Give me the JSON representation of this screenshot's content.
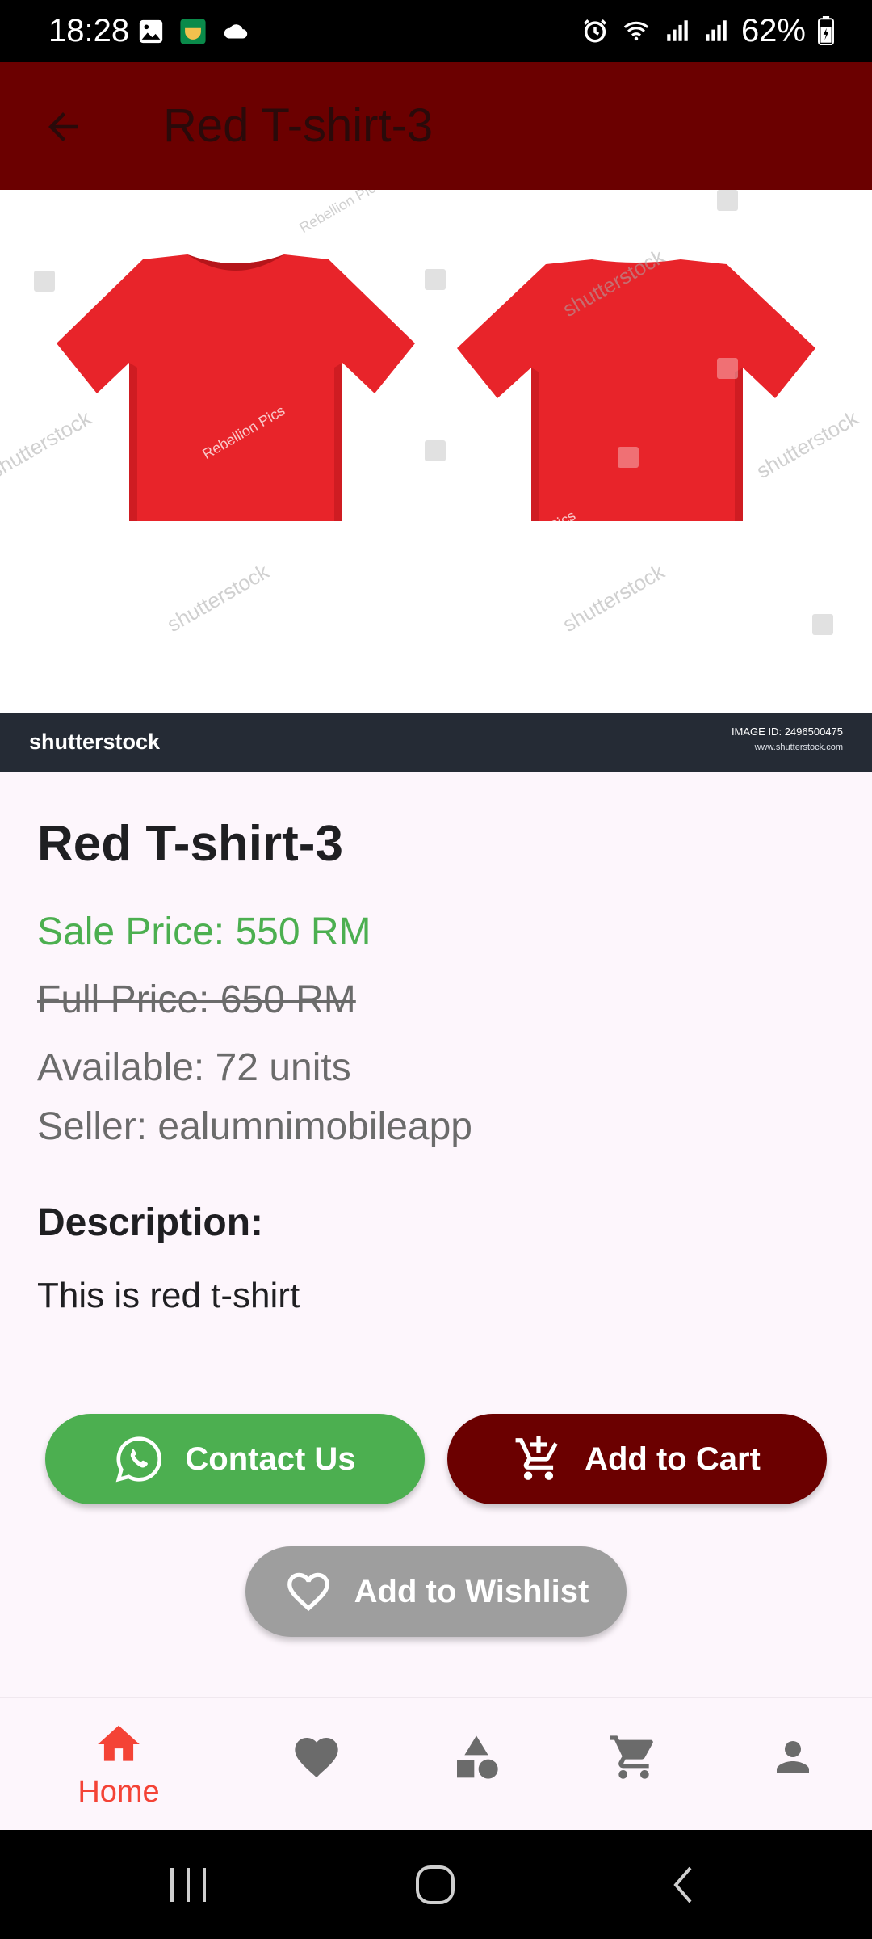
{
  "status_bar": {
    "time": "18:28",
    "battery": "62%",
    "icons": [
      "gallery-icon",
      "app-icon",
      "cloud-icon",
      "alarm-icon",
      "wifi-icon",
      "signal-icon",
      "signal-icon-2",
      "battery-icon"
    ]
  },
  "app_bar": {
    "title": "Red T-shirt-3",
    "back_icon": "back-arrow-icon",
    "background": "#6b0000"
  },
  "product_image": {
    "watermark_logo": "shutterstock",
    "image_id_label": "IMAGE ID:",
    "image_id": "2496500475",
    "site": "www.shutterstock.com",
    "watermark_text": "shutterstock",
    "credit_text": "Rebellion Pics",
    "shirt_color": "#e8242a"
  },
  "product": {
    "name": "Red T-shirt-3",
    "sale_price": "Sale Price: 550 RM",
    "full_price": "Full Price: 650 RM",
    "available": "Available: 72 units",
    "seller": "Seller: ealumnimobileapp",
    "description_heading": "Description:",
    "description": "This is red t-shirt"
  },
  "actions": {
    "contact_label": "Contact Us",
    "contact_icon": "whatsapp-icon",
    "cart_label": "Add to Cart",
    "cart_icon": "add-cart-icon",
    "wishlist_label": "Add to Wishlist",
    "wishlist_icon": "heart-outline-icon"
  },
  "bottom_nav": {
    "active": "home",
    "items": [
      {
        "id": "home",
        "label": "Home",
        "icon": "home-icon"
      },
      {
        "id": "wishlist",
        "icon": "heart-icon"
      },
      {
        "id": "categories",
        "icon": "shapes-icon"
      },
      {
        "id": "cart",
        "icon": "cart-icon"
      },
      {
        "id": "profile",
        "icon": "person-icon"
      }
    ]
  },
  "colors": {
    "primary": "#6b0000",
    "sale_green": "#4caf50",
    "active_nav": "#f44336",
    "inactive_nav": "#6b6b6b"
  }
}
